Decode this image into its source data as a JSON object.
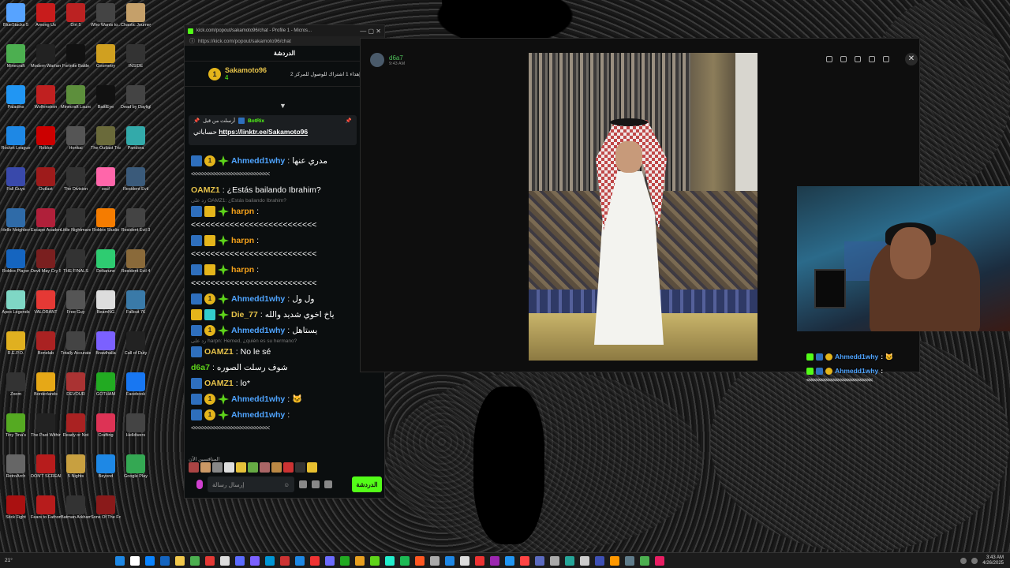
{
  "desktop": {
    "icons": [
      {
        "label": "BlueStacks 5",
        "color": "#57a3ff"
      },
      {
        "label": "Among Us",
        "color": "#c81c1c"
      },
      {
        "label": "Dirt 5",
        "color": "#b22"
      },
      {
        "label": "Who Wants to...",
        "color": "#444"
      },
      {
        "label": "Chaotic Journey",
        "color": "#c5a06a"
      },
      {
        "label": "Minecraft",
        "color": "#4caf50"
      },
      {
        "label": "Modern Warfare",
        "color": "#222"
      },
      {
        "label": "Fortnite Battle",
        "color": "#111"
      },
      {
        "label": "Geometry",
        "color": "#d0a020"
      },
      {
        "label": "INSIDE",
        "color": "#333"
      },
      {
        "label": "Paladins",
        "color": "#2196f3"
      },
      {
        "label": "Wolfenstein",
        "color": "#c02020"
      },
      {
        "label": "Minecraft Launcher",
        "color": "#5d8f3c"
      },
      {
        "label": "BattlEye",
        "color": "#111"
      },
      {
        "label": "Dead by Daylight",
        "color": "#444"
      },
      {
        "label": "Rocket League",
        "color": "#1e88e5"
      },
      {
        "label": "Roblox",
        "color": "#c00"
      },
      {
        "label": "Honkai",
        "color": "#555"
      },
      {
        "label": "The Outlast Trials",
        "color": "#6a6a3a"
      },
      {
        "label": "Pandora",
        "color": "#3aa"
      },
      {
        "label": "Fall Guys",
        "color": "#3949ab"
      },
      {
        "label": "Outlast",
        "color": "#9e1b1b"
      },
      {
        "label": "The Division",
        "color": "#333"
      },
      {
        "label": "osu!",
        "color": "#ff66aa"
      },
      {
        "label": "Resident Evil",
        "color": "#3a5a7a"
      },
      {
        "label": "Hello Neighbor",
        "color": "#2f6ba8"
      },
      {
        "label": "Escape Academy",
        "color": "#b0203a"
      },
      {
        "label": "Little Nightmares",
        "color": "#333"
      },
      {
        "label": "Roblox Studio",
        "color": "#f57c00"
      },
      {
        "label": "Resident Evil 3",
        "color": "#444"
      },
      {
        "label": "Roblox Player",
        "color": "#1565c0"
      },
      {
        "label": "Devil May Cry 5",
        "color": "#7a1f1f"
      },
      {
        "label": "THE FINALS",
        "color": "#333"
      },
      {
        "label": "Deltarune",
        "color": "#2ecc71"
      },
      {
        "label": "Resident Evil 4",
        "color": "#8a6a3a"
      },
      {
        "label": "Apex Legends",
        "color": "#7fd7c5"
      },
      {
        "label": "VALORANT",
        "color": "#e53935"
      },
      {
        "label": "Free Guy",
        "color": "#555"
      },
      {
        "label": "BeamNG",
        "color": "#ddd"
      },
      {
        "label": "Fallout 76",
        "color": "#3a7aa8"
      },
      {
        "label": "R.E.P.O.",
        "color": "#e0b020"
      },
      {
        "label": "Bonelab",
        "color": "#a22"
      },
      {
        "label": "Totally Accurate",
        "color": "#444"
      },
      {
        "label": "Brawlhalla",
        "color": "#7b61ff"
      },
      {
        "label": "Call of Duty",
        "color": "#222"
      },
      {
        "label": "Zoom",
        "color": "#333"
      },
      {
        "label": "Borderlands",
        "color": "#e6a817"
      },
      {
        "label": "DEVOUR",
        "color": "#a33"
      },
      {
        "label": "GOTHAM",
        "color": "#2a2"
      },
      {
        "label": "Facebook",
        "color": "#1877f2"
      },
      {
        "label": "Tiny Tina's",
        "color": "#5a2"
      },
      {
        "label": "The Past Within",
        "color": "#222"
      },
      {
        "label": "Ready or Not",
        "color": "#a22"
      },
      {
        "label": "Crafting",
        "color": "#d35"
      },
      {
        "label": "Helldivers",
        "color": "#444"
      },
      {
        "label": "RetroArch",
        "color": "#666"
      },
      {
        "label": "DON'T SCREAM",
        "color": "#b71c1c"
      },
      {
        "label": "5 Nights",
        "color": "#c8a040"
      },
      {
        "label": "Beyond",
        "color": "#1e88e5"
      },
      {
        "label": "Google Play",
        "color": "#34a853"
      },
      {
        "label": "Stick Fight",
        "color": "#a11"
      },
      {
        "label": "Fears to Fathom",
        "color": "#b71c1c"
      },
      {
        "label": "Batman Arkham",
        "color": "#333"
      },
      {
        "label": "Sons Of The Forest",
        "color": "#8a1a1a"
      }
    ]
  },
  "chat_window": {
    "title": "kick.com/popout/sakamoto96/chat - Profile 1 - Micros...",
    "url": "https://kick.com/popout/sakamoto96/chat",
    "header": "الدردشة",
    "leaderboard": {
      "rank": "1",
      "name": "Sakamoto96",
      "count": "4",
      "goal": "إهداء 1 اشتراك للوصول للمركز 2"
    },
    "pinned": {
      "pinned_by": "أرسلت من قبل",
      "author": "BotRix",
      "label": "حساباتي",
      "link": "https://linktr.ee/Sakamoto96"
    },
    "messages": [
      {
        "user": "Ahmedd1why",
        "color": "#4fa4ff",
        "badges": [
          "bot",
          "one",
          "star"
        ],
        "text": "مدري عنها",
        "tail": "<<<<<<<<<<<<<<<<<<<<<<<<<<<"
      },
      {
        "user": "OAMZ1",
        "color": "#e7c34a",
        "badges": [],
        "text": "¿Estás bailando Ibrahim?"
      },
      {
        "reply": "رد على OAMZ1: ¿Estás bailando Ibrahim?"
      },
      {
        "user": "harpn",
        "color": "#f4a11a",
        "badges": [
          "bot",
          "crown",
          "star"
        ],
        "text": "<<<<<<<<<<<<<<<<<<<<<<<<<<"
      },
      {
        "user": "harpn",
        "color": "#f4a11a",
        "badges": [
          "bot",
          "crown",
          "star"
        ],
        "text": "<<<<<<<<<<<<<<<<<<<<<<<<<<"
      },
      {
        "user": "harpn",
        "color": "#f4a11a",
        "badges": [
          "bot",
          "crown",
          "star"
        ],
        "text": "<<<<<<<<<<<<<<<<<<<<<<<<<<"
      },
      {
        "user": "Ahmedd1why",
        "color": "#4fa4ff",
        "badges": [
          "bot",
          "one",
          "star"
        ],
        "text": "ول ول"
      },
      {
        "user": "Die_77",
        "color": "#e7c34a",
        "badges": [
          "crown",
          "teal",
          "star"
        ],
        "text": "ياخ اخوي شديد والله"
      },
      {
        "user": "Ahmedd1why",
        "color": "#4fa4ff",
        "badges": [
          "bot",
          "one",
          "star"
        ],
        "text": "يستاهل"
      },
      {
        "reply": "رد على harpn: Hemed, ¿quién es su hermano?"
      },
      {
        "user": "OAMZ1",
        "color": "#e7c34a",
        "badges": [
          "bot"
        ],
        "text": "No le sé"
      },
      {
        "user": "d6a7",
        "color": "#5ed41a",
        "badges": [],
        "text": "شوف رسلت الصوره"
      },
      {
        "user": "OAMZ1",
        "color": "#e7c34a",
        "badges": [
          "bot"
        ],
        "text": "lo*"
      },
      {
        "user": "Ahmedd1why",
        "color": "#4fa4ff",
        "badges": [
          "bot",
          "one",
          "star"
        ],
        "text": "🐱"
      },
      {
        "user": "Ahmedd1why",
        "color": "#4fa4ff",
        "badges": [
          "bot",
          "one",
          "star"
        ],
        "text": "",
        "tail": "<<<<<<<<<<<<<<<<<<<<<<<<<<<"
      }
    ],
    "emotes_label": "المنافسين الآن",
    "input_placeholder": "إرسال رسالة",
    "send_label": "الدردشة"
  },
  "viewer": {
    "author": "d6a7",
    "time": "9:43 AM"
  },
  "overlay": {
    "rows": [
      {
        "user": "Ahmedd1why",
        "text": ": 🐱"
      },
      {
        "user": "Ahmedd1why",
        "text": ":"
      }
    ],
    "tail": "<<<<<<<<<<<<<<<<<<<<<<<<<<<"
  },
  "taskbar": {
    "weather": "21°",
    "time": "3:43 AM",
    "date": "4/26/2025"
  }
}
